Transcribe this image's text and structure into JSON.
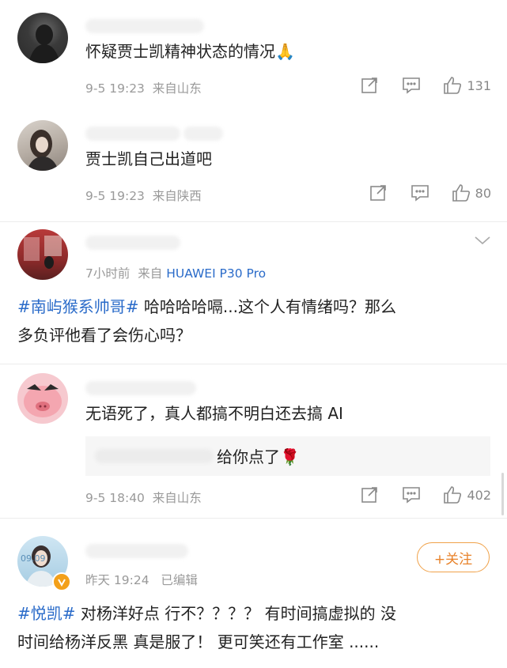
{
  "comments": [
    {
      "text": "怀疑贾士凯精神状态的情况",
      "emoji": "🙏",
      "time": "9-5 19:23",
      "location": "来自山东",
      "likes": "131"
    },
    {
      "text": "贾士凯自己出道吧",
      "time": "9-5 19:23",
      "location": "来自陕西",
      "likes": "80"
    },
    {
      "time": "7小时前",
      "source_prefix": "来自",
      "source_device": "HUAWEI P30 Pro",
      "hashtag": "#南屿猴系帅哥#",
      "text_line1": " 哈哈哈哈嗝...这个人有情绪吗？那么",
      "text_line2": "多负评他看了会伤心吗？"
    },
    {
      "text": "无语死了，真人都搞不明白还去搞 AI",
      "reply_text": "给你点了",
      "reply_emoji": "🌹",
      "time": "9-5 18:40",
      "location": "来自山东",
      "likes": "402"
    },
    {
      "time": "昨天 19:24",
      "edited": "已编辑",
      "follow_label": "+关注",
      "hashtag": "#悦凯#",
      "text_line1": " 对杨洋好点 行不？？？？ 有时间搞虚拟的 没",
      "text_line2": "时间给杨洋反黑 真是服了！ 更可笑还有工作室 ......",
      "avatar_text": "09.09"
    }
  ],
  "colors": {
    "link": "#2a6bc9",
    "meta": "#9a9a9a",
    "follow": "#e8822a"
  }
}
